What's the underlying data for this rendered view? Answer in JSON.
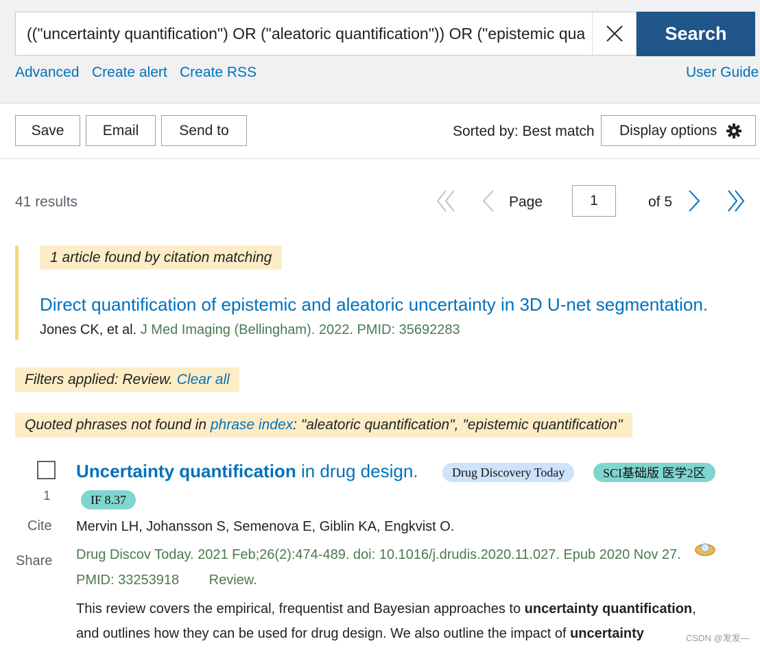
{
  "search": {
    "query": "((\"uncertainty quantification\") OR (\"aleatoric quantification\")) OR (\"epistemic quantification\")",
    "button_label": "Search"
  },
  "links": {
    "advanced": "Advanced",
    "create_alert": "Create alert",
    "create_rss": "Create RSS",
    "user_guide": "User Guide"
  },
  "toolbar": {
    "save": "Save",
    "email": "Email",
    "send_to": "Send to",
    "sorted_by": "Sorted by: Best match",
    "display_options": "Display options"
  },
  "results": {
    "count": "41 results",
    "page_label": "Page",
    "page_value": "1",
    "of_pages": "of 5"
  },
  "citation_match": {
    "label": "1 article found by citation matching",
    "title": "Direct quantification of epistemic and aleatoric uncertainty in 3D U-net segmentation.",
    "authors": "Jones CK, et al.",
    "source": "J Med Imaging (Bellingham). 2022. PMID: 35692283"
  },
  "filters": {
    "text": "Filters applied: Review.",
    "clear": "Clear all"
  },
  "quoted_notice": {
    "prefix": "Quoted phrases not found in",
    "link": "phrase index",
    "suffix": ": \"aleatoric quantification\", \"epistemic quantification\""
  },
  "result_item": {
    "number": "1",
    "cite": "Cite",
    "share": "Share",
    "title_bold": "Uncertainty quantification",
    "title_rest": "in drug design.",
    "badges": {
      "journal": "Drug Discovery Today",
      "sci": "SCI基础版 医学2区",
      "impact": "IF 8.37"
    },
    "authors": "Mervin LH, Johansson S, Semenova E, Giblin KA, Engkvist O.",
    "citation": "Drug Discov Today. 2021 Feb;26(2):474-489. doi: 10.1016/j.drudis.2020.11.027. Epub 2020 Nov 27.",
    "pmid": "PMID: 33253918",
    "type": "Review.",
    "snippet_1": "This review covers the empirical, frequentist and Bayesian approaches to",
    "snippet_1_bold": "uncertainty quantification",
    "snippet_1_end": ",",
    "snippet_2": "and outlines how they can be used for drug design. We also outline the impact of",
    "snippet_2_bold": "uncertainty"
  },
  "watermark": "CSDN @发发—",
  "colors": {
    "link": "#0071bc",
    "search_button": "#20558a",
    "highlight": "#fdedc7",
    "citation_green": "#4a7a50",
    "badge_blue": "#cfe2fb",
    "badge_teal": "#7ed6cf"
  }
}
